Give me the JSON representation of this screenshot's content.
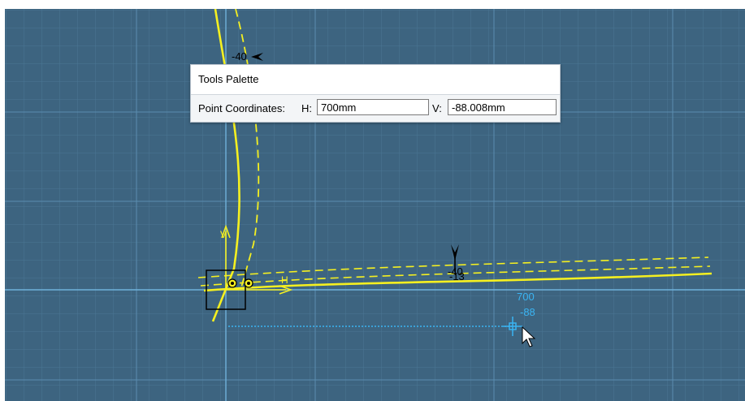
{
  "palette": {
    "title": "Tools Palette",
    "point_coordinates_label": "Point Coordinates:",
    "h_label": "H:",
    "h_value": "700mm",
    "v_label": "V:",
    "v_value": "-88.008mm"
  },
  "canvas": {
    "dimension_top": "-40",
    "dimension_mid_a": "-40",
    "dimension_mid_b": "-13",
    "axis_h_label": "H",
    "axis_v_label": "V",
    "cursor_h": "700",
    "cursor_v": "-88"
  },
  "colors": {
    "background": "#3d6480",
    "grid_minor": "#4a7694",
    "grid_major": "#5a8db0",
    "curve": "#f5f020",
    "cursor_cyan": "#3ab4f2"
  }
}
